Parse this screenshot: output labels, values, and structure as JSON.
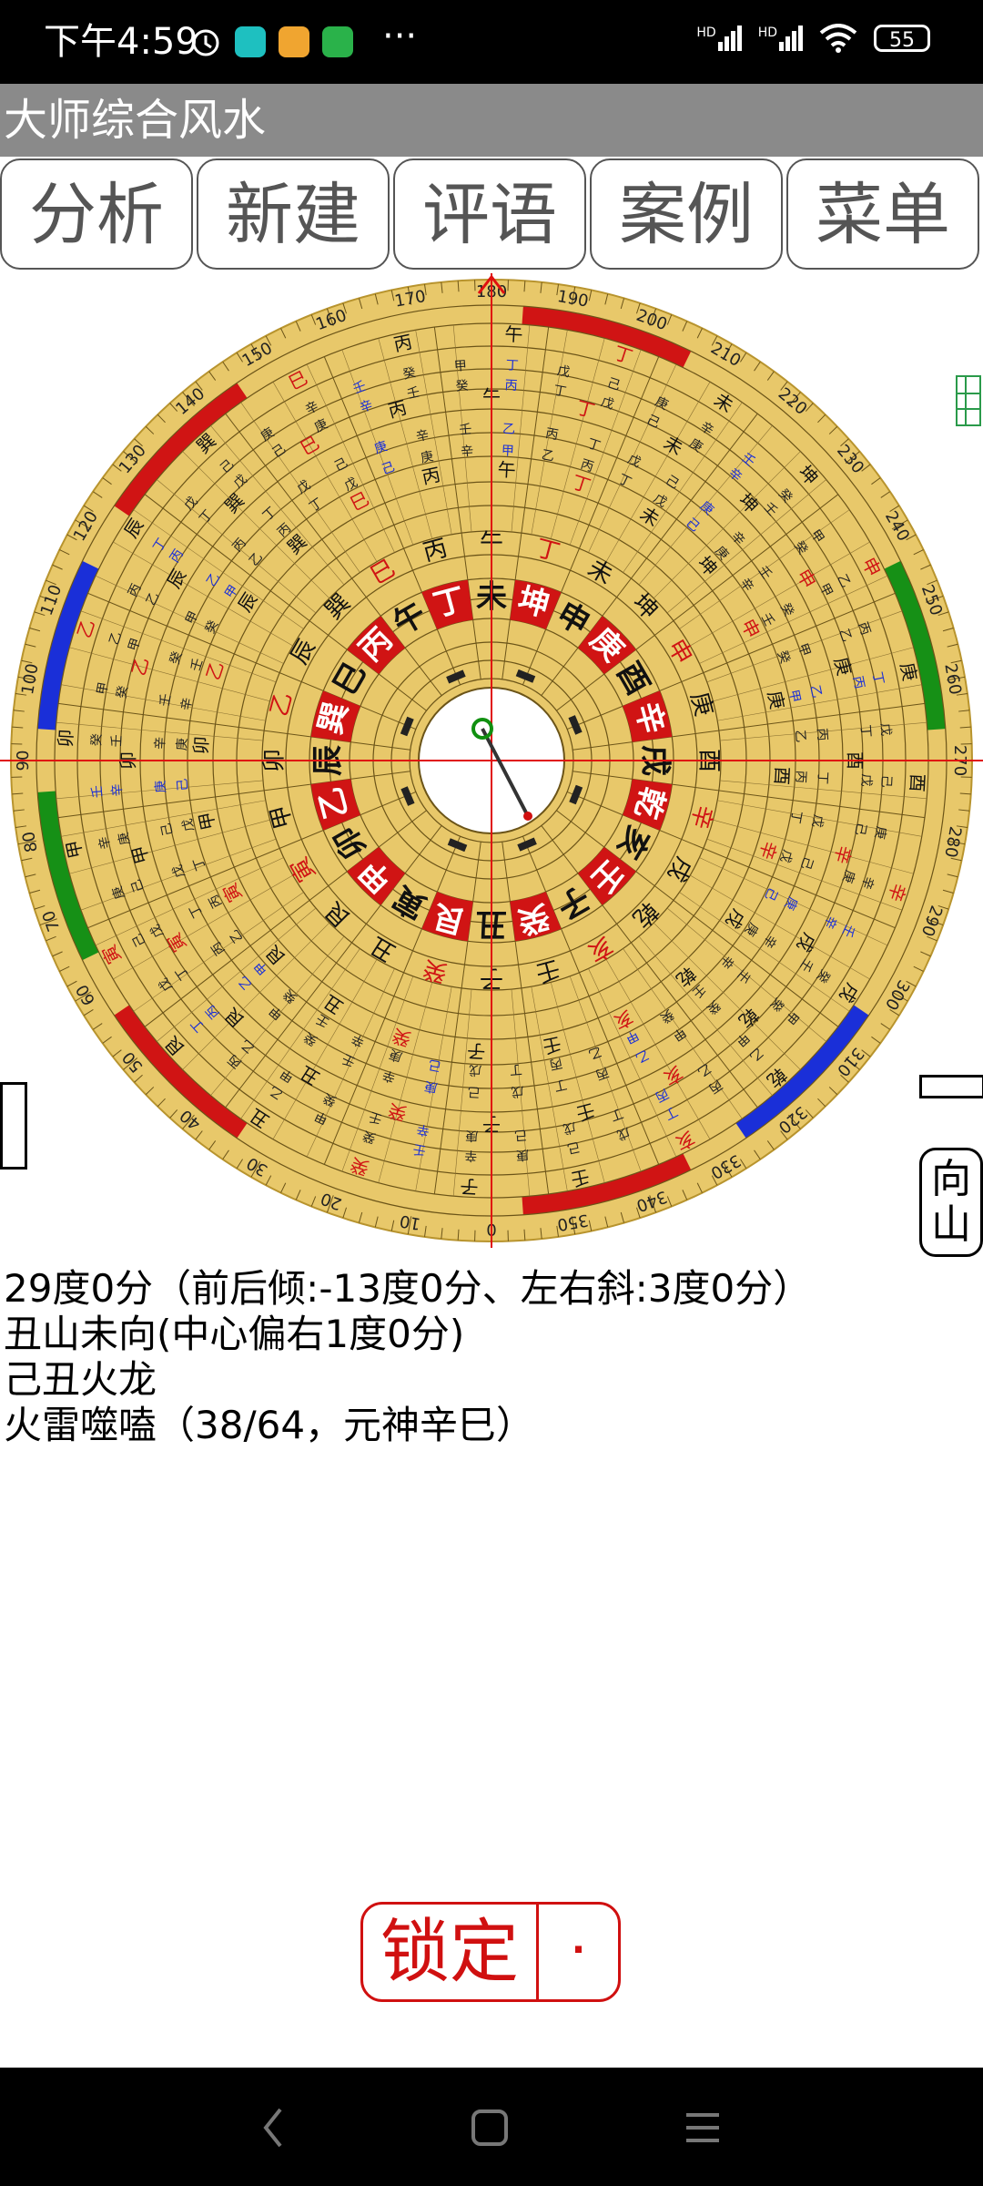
{
  "status": {
    "time": "下午4:59",
    "battery": "55",
    "more": "···",
    "net1": "HD",
    "net2": "HD"
  },
  "app": {
    "title": "大师综合风水"
  },
  "toolbar": {
    "b1": "分析",
    "b2": "新建",
    "b3": "评语",
    "b4": "案例",
    "b5": "菜单"
  },
  "compass": {
    "outer_ticks": [
      "10",
      "20",
      "30",
      "40",
      "50",
      "60",
      "70",
      "80",
      "90",
      "100",
      "110",
      "120",
      "130",
      "140",
      "150",
      "160",
      "170",
      "180",
      "190",
      "200",
      "210",
      "220",
      "230",
      "240",
      "250",
      "260",
      "270",
      "280",
      "290",
      "300",
      "310",
      "320",
      "330",
      "340",
      "350",
      "0"
    ],
    "mountains": [
      "子",
      "癸",
      "丑",
      "艮",
      "寅",
      "甲",
      "卯",
      "乙",
      "辰",
      "巽",
      "巳",
      "丙",
      "午",
      "丁",
      "未",
      "坤",
      "申",
      "庚",
      "酉",
      "辛",
      "戌",
      "乾",
      "亥",
      "壬"
    ],
    "inner_red": [
      "乙",
      "卯",
      "甲",
      "寅",
      "艮",
      "丑",
      "癸",
      "子",
      "壬",
      "亥",
      "乾",
      "戌",
      "辛",
      "酉",
      "庚",
      "申",
      "坤",
      "未",
      "丁",
      "午",
      "丙",
      "巳",
      "巽",
      "辰"
    ],
    "accent_gold": "#e8c86a",
    "accent_red": "#d01414",
    "accent_green": "#169016",
    "accent_blue": "#1a2fd8"
  },
  "shanxiang": {
    "top": "向",
    "bottom": "山"
  },
  "info": {
    "line1": "29度0分（前后倾:-13度0分、左右斜:3度0分）",
    "line2": "丑山未向(中心偏右1度0分)",
    "line3": "己丑火龙",
    "line4": "火雷噬嗑（38/64，元神辛巳）"
  },
  "lock": {
    "label": "锁定",
    "dot": "·"
  }
}
